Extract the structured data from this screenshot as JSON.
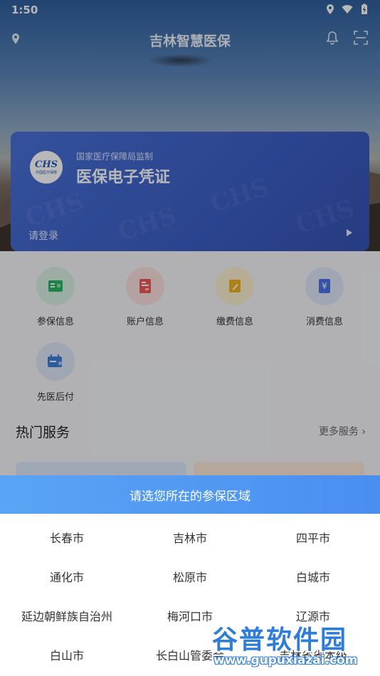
{
  "status": {
    "time": "1:50"
  },
  "app": {
    "title": "吉林智慧医保"
  },
  "card": {
    "logo_text": "CHS",
    "logo_subtext": "中国医疗保障",
    "supervisor": "国家医疗保障局监制",
    "title": "医保电子凭证",
    "login": "请登录"
  },
  "services": [
    {
      "label": "参保信息",
      "icon": "insurance-info-icon",
      "bg": "#d9f1e2",
      "fg": "#2bb463"
    },
    {
      "label": "账户信息",
      "icon": "account-info-icon",
      "bg": "#fde0e0",
      "fg": "#ef5a5a"
    },
    {
      "label": "缴费信息",
      "icon": "payment-info-icon",
      "bg": "#fdf0d2",
      "fg": "#f2b321"
    },
    {
      "label": "消费信息",
      "icon": "consumption-info-icon",
      "bg": "#dfe7fb",
      "fg": "#4d73e6"
    },
    {
      "label": "先医后付",
      "icon": "treat-first-pay-later-icon",
      "bg": "#dde8f7",
      "fg": "#3f7fd9"
    }
  ],
  "hot_services": {
    "title": "热门服务",
    "more": "更多服务"
  },
  "region_picker": {
    "title": "请选您所在的参保区域",
    "cities": [
      "长春市",
      "吉林市",
      "四平市",
      "通化市",
      "松原市",
      "白城市",
      "延边朝鲜族自治州",
      "梅河口市",
      "辽源市",
      "白山市",
      "长白山管委会",
      "吉林省省本级"
    ]
  },
  "watermark": {
    "brand": "谷普软件园",
    "url": "www.gupuxiazai.com"
  },
  "colors": {
    "accent": "#4a8ef0",
    "card": "#3c5fc6"
  }
}
